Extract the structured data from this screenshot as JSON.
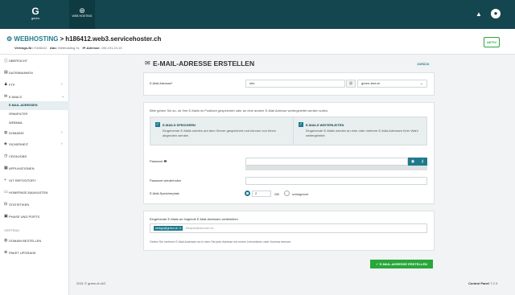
{
  "header": {
    "logo_mark": "G",
    "logo_text": "green",
    "tab_label": "WEB HOSTING"
  },
  "breadcrumb": {
    "section": "WEBHOSTING",
    "separator": ">",
    "host": "h186412.web3.servicehoster.ch",
    "contract_label": "Vertrags-Nr:",
    "contract_value": "H186412",
    "plan_label": "Abo:",
    "plan_value": "Webhosting XL",
    "ip_label": "IP-Adresse:",
    "ip_value": "194.191.24.13",
    "status": "AKTIV"
  },
  "sidebar": {
    "items": [
      {
        "label": "ÜBERSICHT",
        "icon": "info-icon"
      },
      {
        "label": "DATENBANKEN",
        "icon": "database-icon"
      },
      {
        "label": "FTP",
        "icon": "users-icon",
        "chevron": ">"
      },
      {
        "label": "E-MAILS",
        "icon": "envelope-icon",
        "chevron": "v"
      },
      {
        "label": "E-MAIL-ADRESSEN",
        "sub": true,
        "active": true
      },
      {
        "label": "SPAMFILTER",
        "sub": true
      },
      {
        "label": "WEBMAIL",
        "sub": true
      },
      {
        "label": "DOMAINS",
        "icon": "globe-icon",
        "chevron": ">"
      },
      {
        "label": "SICHERHEIT",
        "icon": "shield-icon",
        "chevron": ">"
      },
      {
        "label": "CRONJOBS",
        "icon": "clock-icon"
      },
      {
        "label": "APPLIKATIONEN",
        "icon": "apps-icon"
      },
      {
        "label": "GIT REPOSITORY",
        "icon": "git-icon"
      },
      {
        "label": "HOMEPAGE-BAUKASTEN",
        "icon": "builder-icon"
      },
      {
        "label": "STATISTIKEN",
        "icon": "chart-icon"
      },
      {
        "label": "PHASE UND PORTS",
        "icon": "ports-icon"
      }
    ],
    "section_label": "VERTRAG",
    "contract_items": [
      {
        "label": "DOMAIN BESTELLEN",
        "icon": "globe-icon"
      },
      {
        "label": "PAKET UPGRADE",
        "icon": "upgrade-icon"
      }
    ]
  },
  "main": {
    "title": "E-MAIL-ADRESSE ERSTELLEN",
    "back_label": "ZURÜCK",
    "address_label": "E-Mail Adresse*",
    "address_value": "info",
    "at": "@",
    "domain_value": "green-test.ch",
    "info_text": "Bitte geben Sie an, ob Ihre E-Mails im Postfach gespeichert oder an eine andere E-Mail Adresse weitergeleitet werden sollen.",
    "option_store_title": "E-MAILS SPEICHERN",
    "option_store_desc": "Eingehende E-Mails werden auf dem Server gespeichert und können von Ihnen abgerufen werden",
    "option_forward_title": "E-MAILS WEITERLEITEN",
    "option_forward_desc": "Eingehende E-Mails werden an eine oder mehrere E-Mail-Adressen Ihrer Wahl weitergeleitet",
    "password_label": "Passwort",
    "password_repeat_label": "Passwort wiederholen",
    "quota_label": "E-Mail-Speicherplatz",
    "quota_value": "2",
    "quota_unit": "GB",
    "quota_unlimited": "unbegrenzt",
    "forward_label": "Eingehende E-Mails an folgende E-Mail-Adressen weiterleiten",
    "forward_tag": "sefago@green.ch",
    "forward_placeholder": "Beispiel@domain.ch",
    "forward_hint": "Geben Sie mehrere E-Mail Adressen an in dem Sie jede Adresse mit einem Leerzeichen oder Komma trennen.",
    "submit_label": "E-MAIL-ADRESSE ERSTELLEN"
  },
  "footer": {
    "copyright": "2021 © green.ch AG",
    "panel_label": "Control Panel",
    "panel_version": "7.2.3"
  },
  "colors": {
    "header_bg": "#14464f",
    "accent": "#1f7a8c",
    "success": "#29a63a"
  }
}
